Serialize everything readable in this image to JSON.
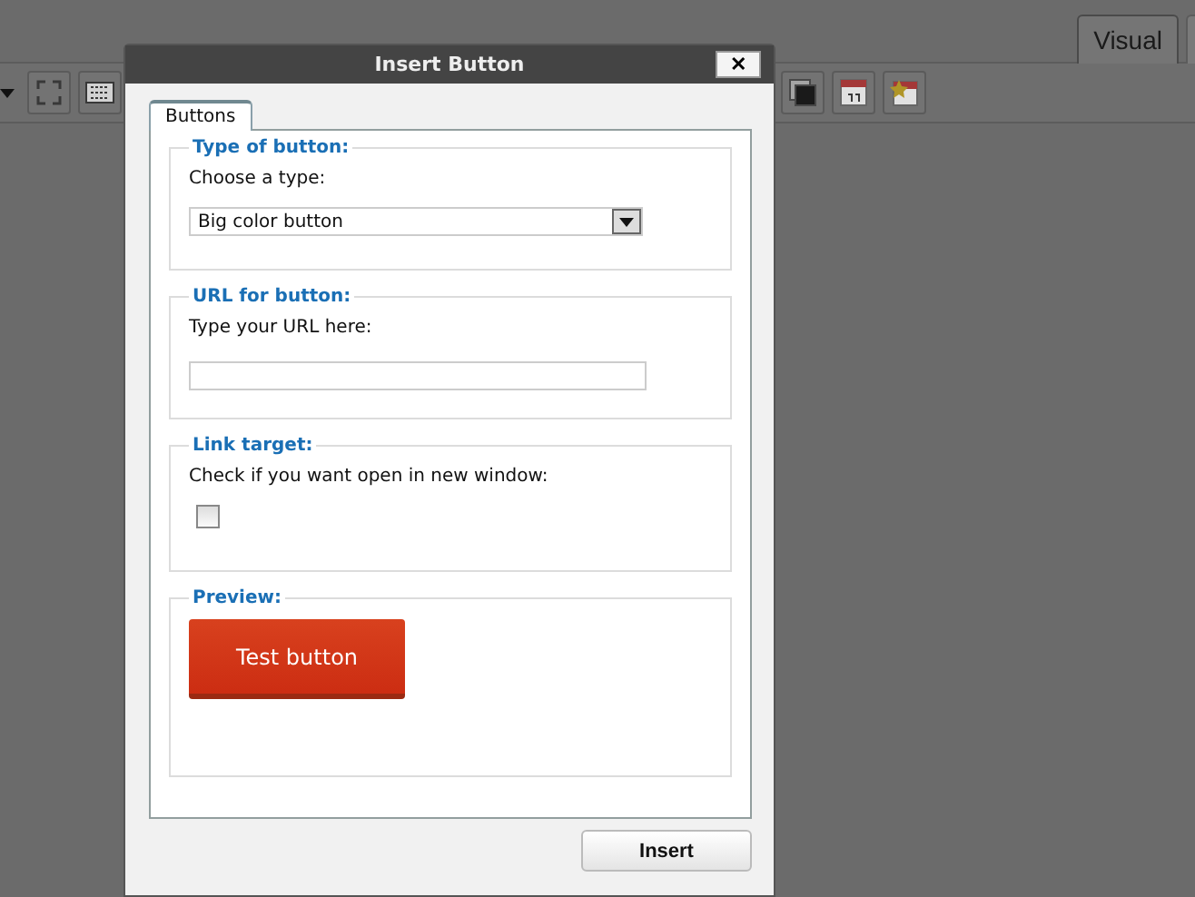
{
  "editor": {
    "tabs": [
      {
        "label": "Visual",
        "selected": true
      }
    ]
  },
  "dialog": {
    "title": "Insert Button",
    "close": "✕",
    "tabs": [
      {
        "label": "Buttons",
        "selected": true
      }
    ],
    "sections": [
      {
        "kind": "select",
        "legend": "Type of button:",
        "label": "Choose a type:",
        "value": "Big color button"
      },
      {
        "kind": "text",
        "legend": "URL for button:",
        "label": "Type your URL here:"
      },
      {
        "kind": "checkbox",
        "legend": "Link target:",
        "label": "Check if you want open in new window:",
        "checked": false
      },
      {
        "kind": "preview",
        "legend": "Preview:",
        "button": "Test button"
      }
    ],
    "action": "Insert"
  }
}
